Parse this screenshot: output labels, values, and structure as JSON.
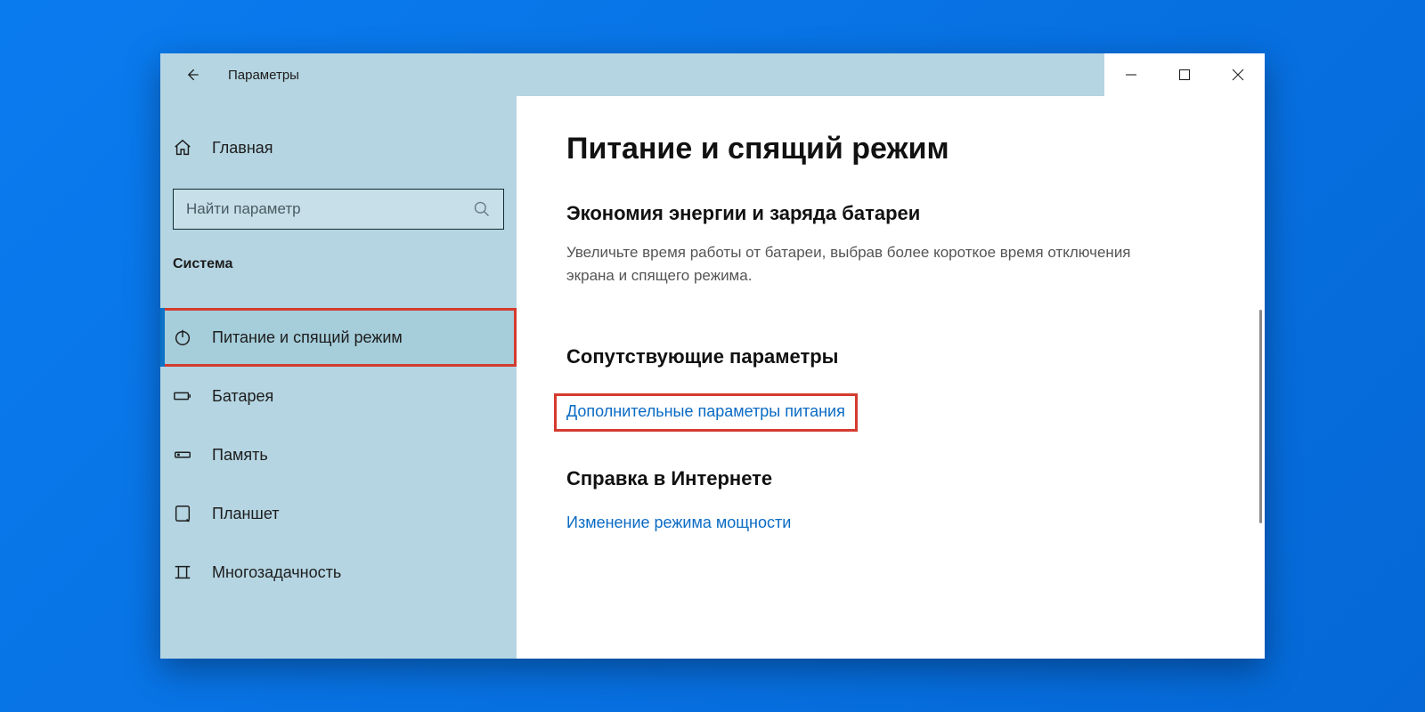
{
  "window": {
    "title": "Параметры"
  },
  "sidebar": {
    "home": "Главная",
    "search_placeholder": "Найти параметр",
    "section": "Система",
    "items": [
      {
        "id": "power",
        "label": "Питание и спящий режим",
        "icon": "power-icon",
        "active": true,
        "highlighted": true
      },
      {
        "id": "battery",
        "label": "Батарея",
        "icon": "battery-icon"
      },
      {
        "id": "storage",
        "label": "Память",
        "icon": "storage-icon"
      },
      {
        "id": "tablet",
        "label": "Планшет",
        "icon": "tablet-icon"
      },
      {
        "id": "multitask",
        "label": "Многозадачность",
        "icon": "multitask-icon"
      }
    ]
  },
  "main": {
    "title": "Питание и спящий режим",
    "section1_heading": "Экономия энергии и заряда батареи",
    "section1_desc": "Увеличьте время работы от батареи, выбрав более короткое время отключения экрана и спящего режима.",
    "section2_heading": "Сопутствующие параметры",
    "section2_link": "Дополнительные параметры питания",
    "section3_heading": "Справка в Интернете",
    "section3_link": "Изменение режима мощности"
  },
  "colors": {
    "highlight": "#d53a2f",
    "link": "#0a6bc4"
  }
}
